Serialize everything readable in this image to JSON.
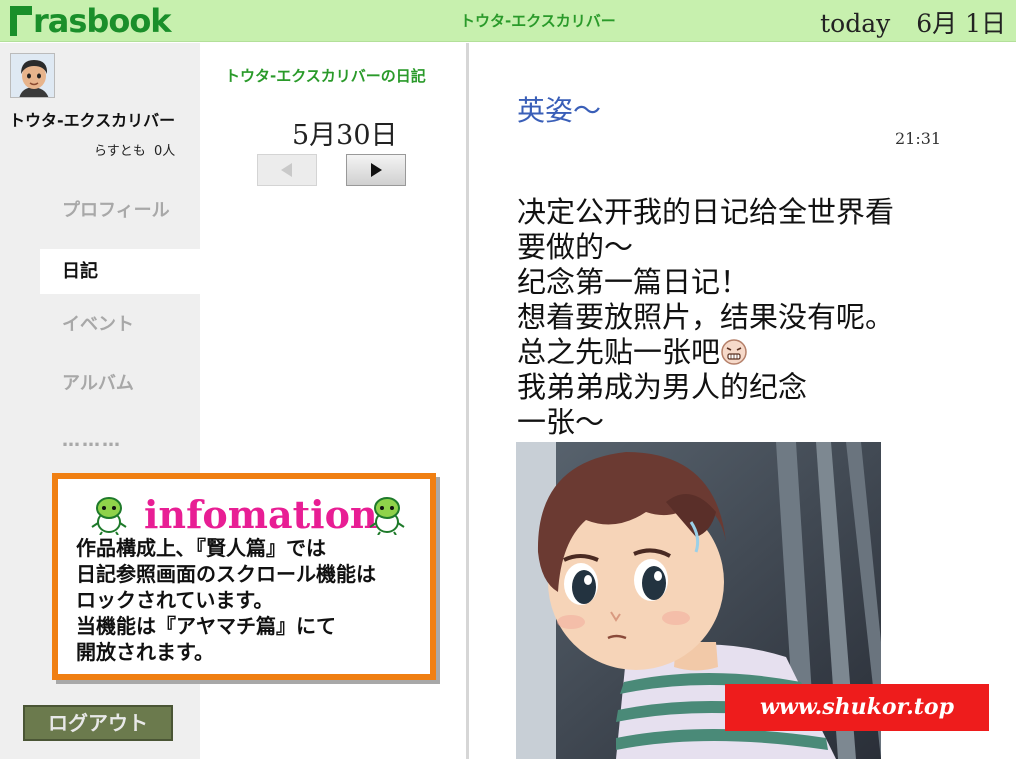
{
  "header": {
    "logo_text": "rasbook",
    "current_user_name": "トウタ-エクスカリバー",
    "today_label": "today",
    "today_date": "6月 1日"
  },
  "sidebar": {
    "user_name": "トウタ-エクスカリバー",
    "friends_label": "らすとも",
    "friends_count": "0人",
    "nav": [
      {
        "label": "プロフィール",
        "active": false
      },
      {
        "label": "日記",
        "active": true
      },
      {
        "label": "イベント",
        "active": false
      },
      {
        "label": "アルバム",
        "active": false
      },
      {
        "label": "………",
        "active": false
      }
    ],
    "logout_label": "ログアウト"
  },
  "info_box": {
    "title": "infomation",
    "lines": [
      "作品構成上､『賢人篇』では",
      "日記参照画面のスクロール機能は",
      "ロックされています。",
      "当機能は『アヤマチ篇』にて",
      "開放されます。"
    ]
  },
  "diary_nav": {
    "title": "トウタ-エクスカリバーの日記",
    "date": "5月30日"
  },
  "entry": {
    "title": "英姿～",
    "time": "21:31",
    "lines": [
      "决定公开我的日记给全世界看",
      "要做的～",
      "纪念第一篇日记！",
      "想着要放照片，结果没有呢。",
      "总之先贴一张吧",
      "我弟弟成为男人的纪念",
      "一张～"
    ]
  },
  "watermark": "www.shukor.top",
  "colors": {
    "header_bg": "#c7f0ae",
    "brand_green": "#1a8f2a",
    "title_blue": "#3a5fb8",
    "info_border": "#f07f12",
    "info_title": "#e81e94",
    "watermark_bg": "#ee1c1c"
  }
}
